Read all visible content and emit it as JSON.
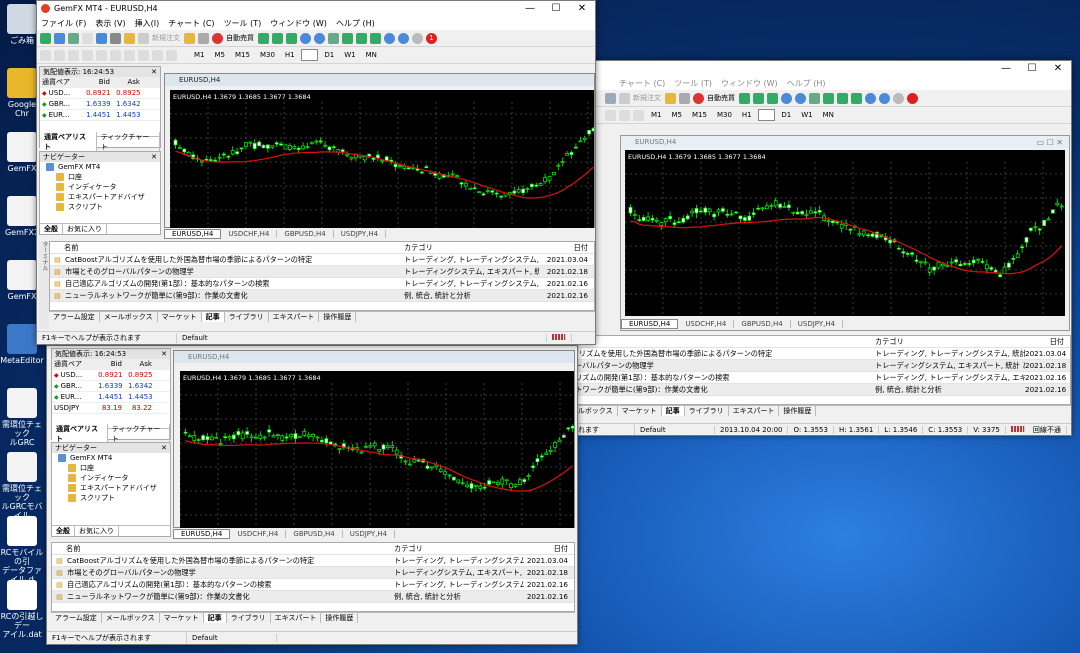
{
  "desktop": [
    {
      "label": "ごみ箱",
      "color": "#cfd8e3"
    },
    {
      "label": "Google Chr",
      "color": "#e8b82a"
    },
    {
      "label": "GemFX",
      "color": "#f3f3f3"
    },
    {
      "label": "GemFX2",
      "color": "#f3f3f3"
    },
    {
      "label": "GemFX",
      "color": "#f3f3f3"
    },
    {
      "label": "MetaEditor",
      "color": "#3c78c8"
    },
    {
      "label": "需環位チェック\nルGRC",
      "color": "#f3f3f3"
    },
    {
      "label": "需環位チェック\nルGRCモバイル",
      "color": "#f3f3f3"
    },
    {
      "label": "RCモバイルの引\nデータファイル.d",
      "color": "#fff"
    },
    {
      "label": "RCの引越しデー\nアイル.dat",
      "color": "#fff"
    }
  ],
  "window": {
    "title": "GemFX MT4 - EURUSD,H4",
    "menus": [
      "ファイル (F)",
      "表示 (V)",
      "挿入(I)",
      "チャート (C)",
      "ツール (T)",
      "ウィンドウ (W)",
      "ヘルプ (H)"
    ],
    "new_order": "新規注文",
    "auto_trade": "自動売買",
    "timeframes": [
      "M1",
      "M5",
      "M15",
      "M30",
      "H1",
      "H4",
      "D1",
      "W1",
      "MN"
    ],
    "selected_tf": "H4",
    "notif_count": "1"
  },
  "quotes": {
    "title": "気配値表示: 16:24:53",
    "cols": [
      "通貨ペア",
      "Bid",
      "Ask"
    ],
    "rows": [
      {
        "sym": "USD...",
        "bid": "0.8921",
        "ask": "0.8925",
        "dir": "down"
      },
      {
        "sym": "GBR...",
        "bid": "1.6339",
        "ask": "1.6342",
        "dir": "up"
      },
      {
        "sym": "EUR...",
        "bid": "1.4451",
        "ask": "1.4453",
        "dir": "up"
      }
    ],
    "extra_row": {
      "sym": "USDJPY",
      "bid": "83.19",
      "ask": "83.22"
    },
    "tabs": [
      "通貨ペアリスト",
      "ティックチャート"
    ]
  },
  "navigator": {
    "title": "ナビゲーター",
    "items": [
      "GemFX MT4",
      "口座",
      "インディケータ",
      "エキスパートアドバイザ",
      "スクリプト"
    ],
    "tabs": [
      "全般",
      "お気に入り"
    ]
  },
  "chart": {
    "title": "EURUSD,H4",
    "ohlc": "EURUSD,H4  1.3679 1.3685 1.3677 1.3684",
    "tabs": [
      "EURUSD,H4",
      "USDCHF,H4",
      "GBPUSD,H4",
      "USDJPY,H4"
    ]
  },
  "terminal": {
    "cols": {
      "name": "名前",
      "cat": "カテゴリ",
      "date": "日付"
    },
    "side_label": "ターミナル",
    "rows": [
      {
        "name": "CatBoostアルゴリズムを使用した外国為替市場の季節によるパターンの特定",
        "cat": "トレーディング, トレーディングシステム, 統計 と 分析",
        "date": "2021.03.04"
      },
      {
        "name": "市場とそのグローバルパターンの物理学",
        "cat": "トレーディングシステム, エキスパート, 統計 と 分析",
        "date": "2021.02.18"
      },
      {
        "name": "自己適応アルゴリズムの開発(第1部）：基本的なパターンの検索",
        "cat": "トレーディング, トレーディングシステム, エキスパート",
        "date": "2021.02.16"
      },
      {
        "name": "ニューラルネットワークが簡単に(第9部)：作業の文書化",
        "cat": "例, 統合, 統計と分析",
        "date": "2021.02.16"
      }
    ],
    "tabs": [
      "アラーム設定",
      "メールボックス",
      "マーケット",
      "記事",
      "ライブラリ",
      "エキスパート",
      "操作履歴"
    ],
    "active_tab": "記事"
  },
  "status": {
    "help": "F1キーでヘルプが表示されます",
    "profile": "Default",
    "time": "2013.10.04 20:00",
    "o": "O: 1.3553",
    "h": "H: 1.3561",
    "l": "L: 1.3546",
    "c": "C: 1.3553",
    "v": "V: 3375",
    "conn": "回線不通"
  },
  "colors": {
    "bull": "#00ff00",
    "bear": "#ffffff",
    "ma": "#e01010",
    "chart_bg": "#000000"
  }
}
